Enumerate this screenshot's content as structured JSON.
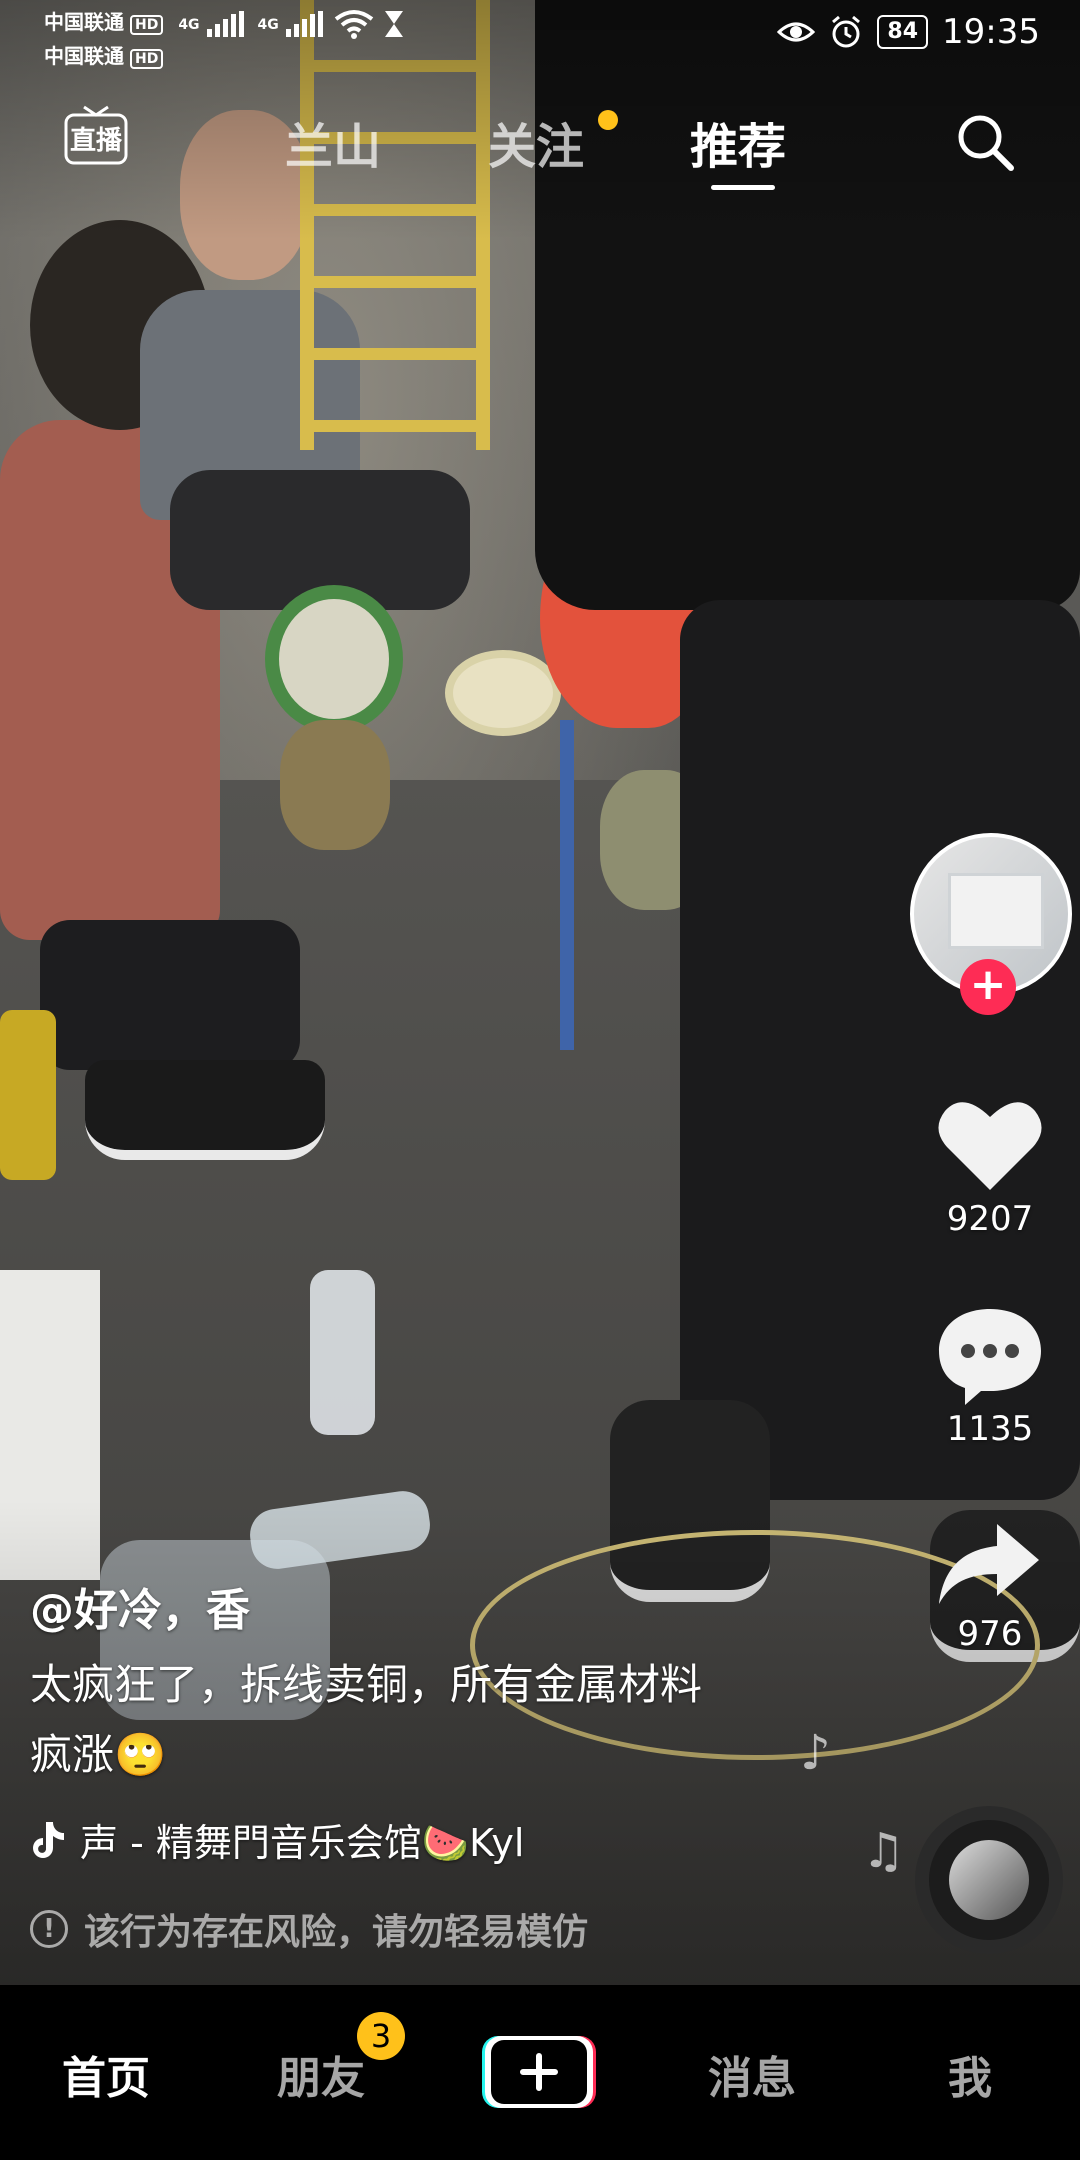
{
  "status_bar": {
    "carrier_1": "中国联通",
    "carrier_2": "中国联通",
    "hd_label": "HD",
    "network_label": "4G",
    "battery_level": "84",
    "time": "19:35"
  },
  "top_nav": {
    "tabs": [
      {
        "label": "兰山"
      },
      {
        "label": "关注"
      },
      {
        "label": "推荐"
      }
    ],
    "active_tab": "推荐"
  },
  "right_rail": {
    "like_count": "9207",
    "comment_count": "1135",
    "share_count": "976"
  },
  "post": {
    "author": "@好冷，香",
    "description_line1": "太疯狂了，拆线卖铜，所有金属材料",
    "description_line2": "疯涨🙄",
    "music": "声 - 精舞門音乐会馆🍉Kyl",
    "warning": "该行为存在风险，请勿轻易模仿"
  },
  "bottom_nav": {
    "items": [
      {
        "label": "首页"
      },
      {
        "label": "朋友"
      },
      {
        "label": "消息"
      },
      {
        "label": "我"
      }
    ],
    "friends_badge": "3"
  },
  "colors": {
    "accent_red": "#fe2c55",
    "badge_yellow": "#ffc11a",
    "nav_bg": "#000000"
  }
}
